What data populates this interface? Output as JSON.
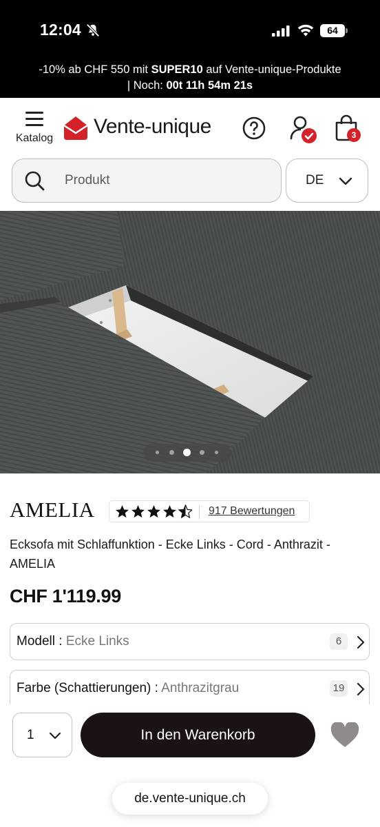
{
  "status_bar": {
    "time": "12:04",
    "battery": "64"
  },
  "promo": {
    "prefix": "-10% ab CHF 550 mit ",
    "code": "SUPER10",
    "suffix": " auf Vente-unique-Produkte",
    "countdown_prefix": "| Noch: ",
    "countdown": "00t 11h 54m 21s"
  },
  "header": {
    "menu_label": "Katalog",
    "logo_text": "Vente-unique",
    "cart_count": "3",
    "brand_color": "#d3222a"
  },
  "search": {
    "placeholder": "Produkt",
    "language": "DE"
  },
  "carousel": {
    "slide_count": 5,
    "active_index": 2
  },
  "product": {
    "brand": "AMELIA",
    "rating": 4.5,
    "rating_max": 5,
    "reviews": "917 Bewertungen",
    "title": "Ecksofa mit Schlaffunktion - Ecke Links - Cord - Anthrazit - AMELIA",
    "price": "CHF 1'119.99"
  },
  "options": [
    {
      "label": "Modell : ",
      "value": "Ecke Links",
      "count": "6"
    },
    {
      "label": "Farbe (Schattierungen) : ",
      "value": "Anthrazitgrau",
      "count": "19"
    }
  ],
  "purchase": {
    "quantity": "1",
    "add_to_cart_label": "In den Warenkorb"
  },
  "browser": {
    "url": "de.vente-unique.ch"
  }
}
